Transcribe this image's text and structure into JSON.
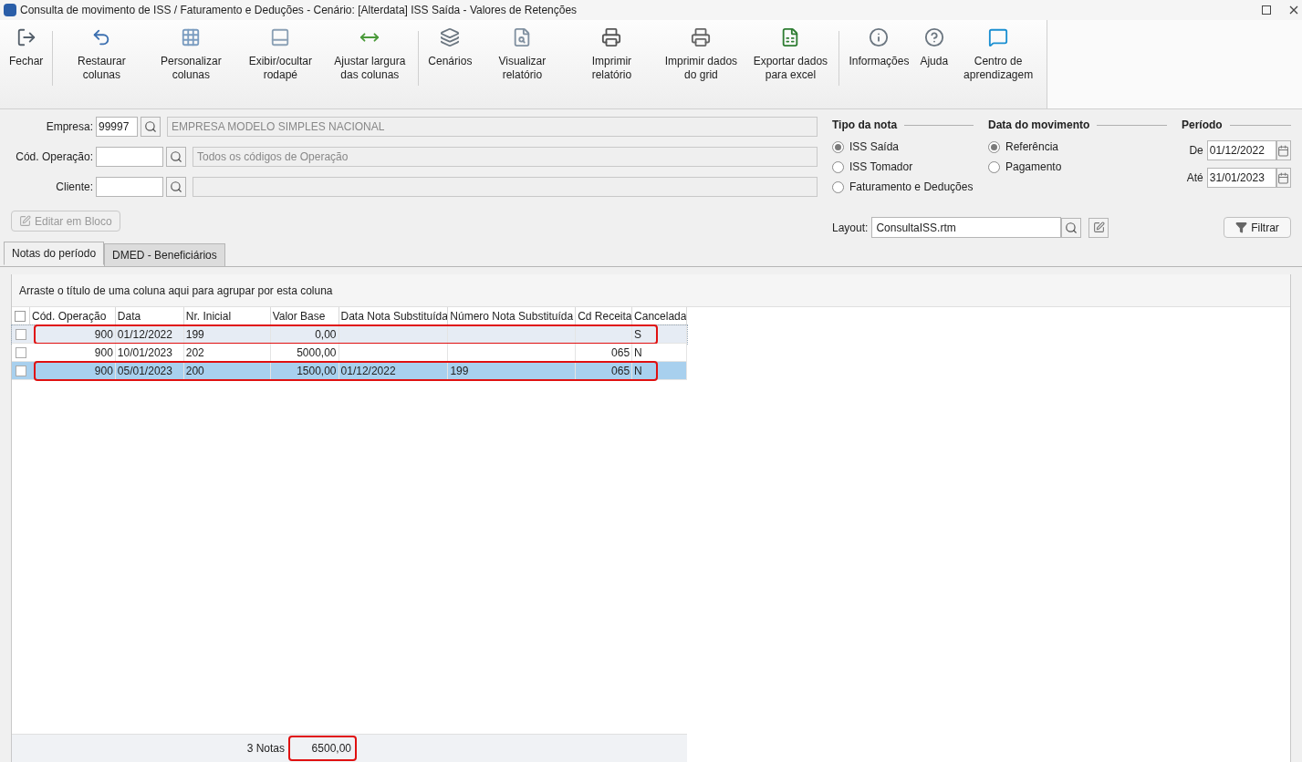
{
  "window": {
    "title": "Consulta de movimento de ISS / Faturamento e Deduções - Cenário: [Alterdata] ISS Saída - Valores de Retenções"
  },
  "toolbar": [
    {
      "kind": "exit",
      "label": "Fechar"
    },
    {
      "kind": "restore",
      "label": "Restaurar colunas",
      "sep": true
    },
    {
      "kind": "grid",
      "label": "Personalizar colunas"
    },
    {
      "kind": "footer",
      "label": "Exibir/ocultar rodapé"
    },
    {
      "kind": "width",
      "label": "Ajustar largura das colunas"
    },
    {
      "kind": "windows",
      "label": "Cenários",
      "sep": true
    },
    {
      "kind": "preview",
      "label": "Visualizar relatório"
    },
    {
      "kind": "print",
      "label": "Imprimir relatório"
    },
    {
      "kind": "printgrid",
      "label": "Imprimir dados do grid"
    },
    {
      "kind": "excel",
      "label": "Exportar dados para excel"
    },
    {
      "kind": "info",
      "label": "Informações",
      "sep": true
    },
    {
      "kind": "help",
      "label": "Ajuda"
    },
    {
      "kind": "chat",
      "label": "Centro de aprendizagem"
    }
  ],
  "filters": {
    "empresa": {
      "label": "Empresa:",
      "code": "99997",
      "name": "EMPRESA MODELO SIMPLES NACIONAL"
    },
    "operacao": {
      "label": "Cód. Operação:",
      "placeholder": "Todos os códigos de Operação"
    },
    "cliente": {
      "label": "Cliente:"
    }
  },
  "tipo_da_nota": {
    "title": "Tipo da nota",
    "options": [
      {
        "label": "ISS Saída",
        "selected": true
      },
      {
        "label": "ISS Tomador",
        "selected": false
      },
      {
        "label": "Faturamento e Deduções",
        "selected": false
      }
    ]
  },
  "data_do_movimento": {
    "title": "Data do movimento",
    "options": [
      {
        "label": "Referência",
        "selected": true
      },
      {
        "label": "Pagamento",
        "selected": false
      }
    ]
  },
  "periodo": {
    "title": "Período",
    "from_label": "De",
    "from": "01/12/2022",
    "to_label": "Até",
    "to": "31/01/2023"
  },
  "edit_block_button": {
    "label": "Editar em Bloco",
    "disabled": true
  },
  "layout": {
    "label": "Layout:",
    "value": "ConsultaISS.rtm"
  },
  "filter_button": "Filtrar",
  "tabs": [
    {
      "label": "Notas do período",
      "selected": true
    },
    {
      "label": "DMED - Beneficiários",
      "selected": false
    }
  ],
  "group_hint": "Arraste o título de uma coluna aqui para agrupar por esta coluna",
  "table": {
    "select_all_checked": false,
    "columns": [
      "Cód. Operação",
      "Data",
      "Nr. Inicial",
      "Valor Base",
      "Data Nota Substituída",
      "Número Nota Substituída",
      "Cd Receita",
      "Cancelada"
    ],
    "rows": [
      {
        "cells": [
          "900",
          "01/12/2022",
          "199",
          "0,00",
          "",
          "",
          "",
          "S"
        ],
        "checked": false,
        "selected": false,
        "focused": true,
        "annotated": true
      },
      {
        "cells": [
          "900",
          "10/01/2023",
          "202",
          "5000,00",
          "",
          "",
          "065",
          "N"
        ],
        "checked": false,
        "selected": false,
        "focused": false,
        "annotated": false
      },
      {
        "cells": [
          "900",
          "05/01/2023",
          "200",
          "1500,00",
          "01/12/2022",
          "199",
          "065",
          "N"
        ],
        "checked": false,
        "selected": true,
        "focused": false,
        "annotated": true
      }
    ]
  },
  "footer": {
    "count": "3 Notas",
    "total": "6500,00",
    "total_annotated": true
  }
}
